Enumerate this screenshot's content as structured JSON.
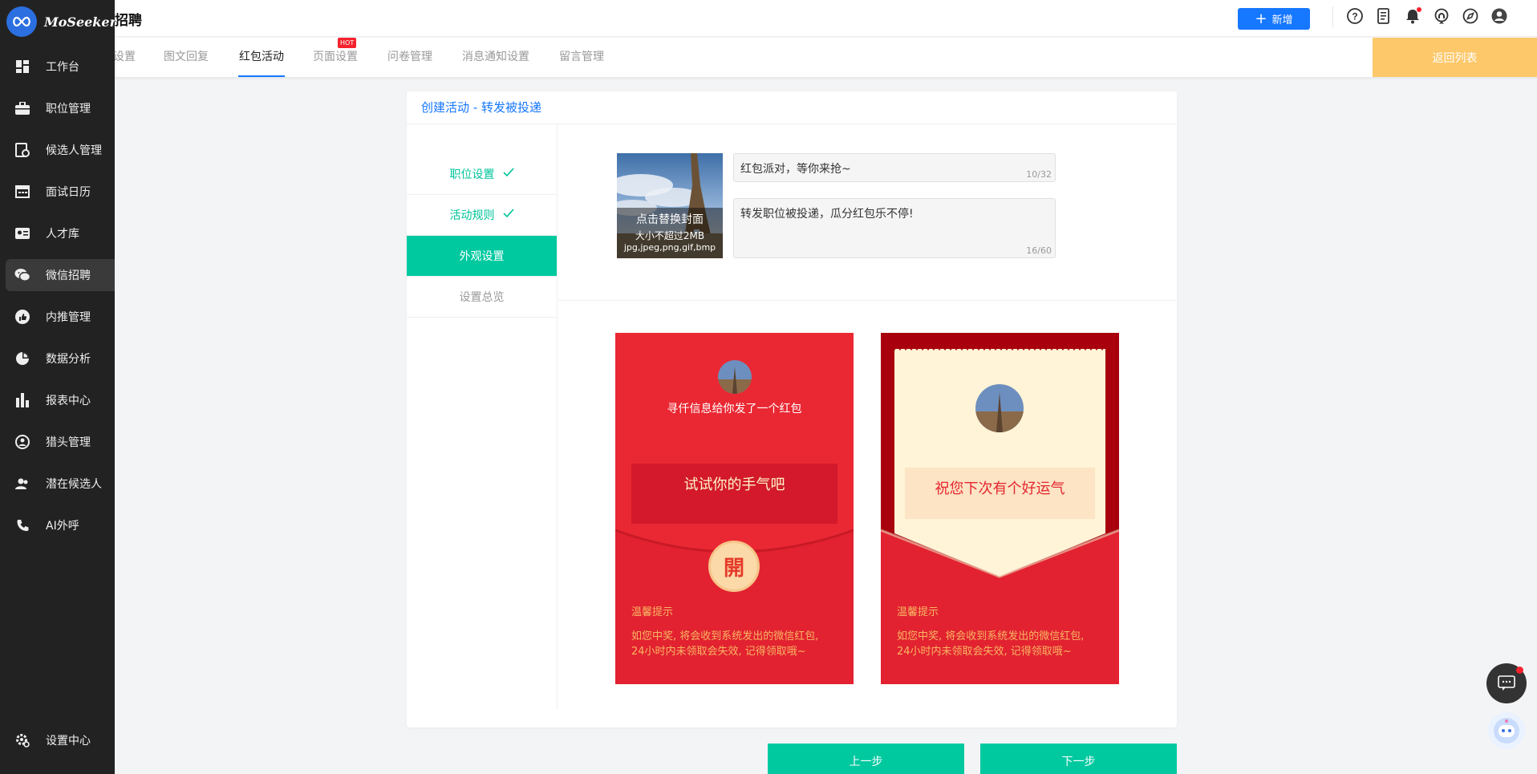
{
  "brand": {
    "logo_text": "MoSeeker",
    "page_title": "招聘"
  },
  "sidebar": {
    "items": [
      {
        "label": "工作台",
        "icon": "dashboard-icon"
      },
      {
        "label": "职位管理",
        "icon": "briefcase-icon"
      },
      {
        "label": "候选人管理",
        "icon": "candidate-icon"
      },
      {
        "label": "面试日历",
        "icon": "calendar-icon"
      },
      {
        "label": "人才库",
        "icon": "id-card-icon"
      },
      {
        "label": "微信招聘",
        "icon": "wechat-icon"
      },
      {
        "label": "内推管理",
        "icon": "thumb-up-icon"
      },
      {
        "label": "数据分析",
        "icon": "pie-chart-icon"
      },
      {
        "label": "报表中心",
        "icon": "bar-chart-icon"
      },
      {
        "label": "猎头管理",
        "icon": "headhunter-icon"
      },
      {
        "label": "潜在候选人",
        "icon": "people-icon"
      },
      {
        "label": "AI外呼",
        "icon": "phone-icon"
      }
    ],
    "settings_label": "设置中心",
    "active_index": 5
  },
  "topbar": {
    "add_label": "新增",
    "icons": [
      "help-icon",
      "document-icon",
      "bell-icon",
      "headset-icon",
      "compass-icon",
      "user-icon"
    ]
  },
  "tabs": {
    "items": [
      "设置",
      "图文回复",
      "红包活动",
      "页面设置",
      "问卷管理",
      "消息通知设置",
      "留言管理"
    ],
    "active": "红包活动",
    "hot_badge": "HOT",
    "back_label": "返回列表"
  },
  "card": {
    "title": "创建活动 - 转发被投递",
    "steps": [
      {
        "label": "职位设置",
        "state": "done"
      },
      {
        "label": "活动规则",
        "state": "done"
      },
      {
        "label": "外观设置",
        "state": "active"
      },
      {
        "label": "设置总览",
        "state": "pending"
      }
    ],
    "cover": {
      "line1": "点击替换封面",
      "line2": "大小不超过2MB",
      "line3": "jpg,jpeg,png,gif,bmp"
    },
    "title_input": {
      "value": "红包派对，等你来抢~",
      "count": "10/32"
    },
    "desc_input": {
      "value": "转发职位被投递，瓜分红包乐不停!",
      "count": "16/60"
    }
  },
  "packet1": {
    "sender_text": "寻仟信息给你发了一个红包",
    "box_text": "试试你的手气吧",
    "open_char": "開",
    "tip_title": "温馨提示",
    "tip_line1": "如您中奖, 将会收到系统发出的微信红包,",
    "tip_line2": "24小时内未领取会失效, 记得领取哦~"
  },
  "packet2": {
    "box_text": "祝您下次有个好运气",
    "tip_title": "温馨提示",
    "tip_line1": "如您中奖, 将会收到系统发出的微信红包,",
    "tip_line2": "24小时内未领取会失效, 记得领取哦~"
  },
  "buttons": {
    "prev": "上一步",
    "next": "下一步"
  },
  "colors": {
    "accent": "#1677ff",
    "teal": "#00c9a0",
    "packet_red": "#ea2833",
    "back_orange": "#fdc86a"
  }
}
